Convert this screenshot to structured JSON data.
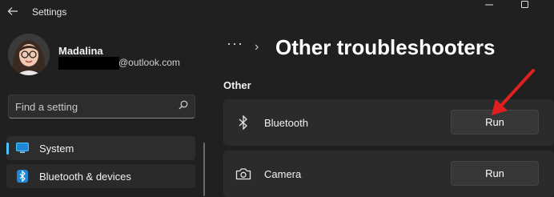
{
  "window": {
    "title": "Settings",
    "back_icon": "back-arrow-icon",
    "controls": [
      "minimize-icon",
      "maximize-icon"
    ]
  },
  "account": {
    "name": "Madalina",
    "email_suffix": "@outlook.com"
  },
  "search": {
    "placeholder": "Find a setting",
    "value": "",
    "icon": "search-icon"
  },
  "sidebar": {
    "items": [
      {
        "label": "System",
        "icon": "monitor-icon",
        "selected": true
      },
      {
        "label": "Bluetooth & devices",
        "icon": "bluetooth-icon",
        "selected": false
      }
    ]
  },
  "breadcrumb": {
    "more": "···",
    "separator": "›",
    "title": "Other troubleshooters"
  },
  "section": {
    "header": "Other",
    "items": [
      {
        "label": "Bluetooth",
        "icon": "bluetooth-icon",
        "button": "Run"
      },
      {
        "label": "Camera",
        "icon": "camera-icon",
        "button": "Run"
      }
    ]
  },
  "colors": {
    "background": "#202020",
    "card": "#2b2b2b",
    "accent": "#4cc2ff",
    "annotation_arrow": "#e02020"
  }
}
